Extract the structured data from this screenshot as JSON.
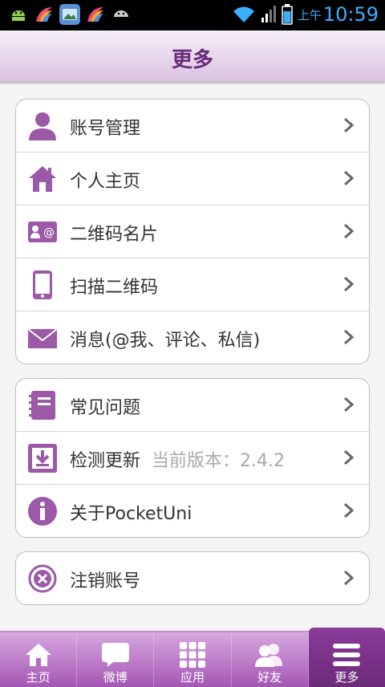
{
  "status_bar": {
    "ampm": "上午",
    "time": "10:59"
  },
  "header": {
    "title": "更多"
  },
  "groups": [
    {
      "items": [
        {
          "label": "账号管理"
        },
        {
          "label": "个人主页"
        },
        {
          "label": "二维码名片"
        },
        {
          "label": "扫描二维码"
        },
        {
          "label": "消息(@我、评论、私信)"
        }
      ]
    },
    {
      "items": [
        {
          "label": "常见问题"
        },
        {
          "label": "检测更新",
          "sub": "当前版本：2.4.2"
        },
        {
          "label": "关于PocketUni"
        }
      ]
    },
    {
      "items": [
        {
          "label": "注销账号"
        }
      ]
    }
  ],
  "tabs": [
    {
      "label": "主页"
    },
    {
      "label": "微博"
    },
    {
      "label": "应用"
    },
    {
      "label": "好友"
    },
    {
      "label": "更多",
      "active": true
    }
  ],
  "colors": {
    "accent": "#9b59a8",
    "header_text": "#6a2a7a"
  }
}
